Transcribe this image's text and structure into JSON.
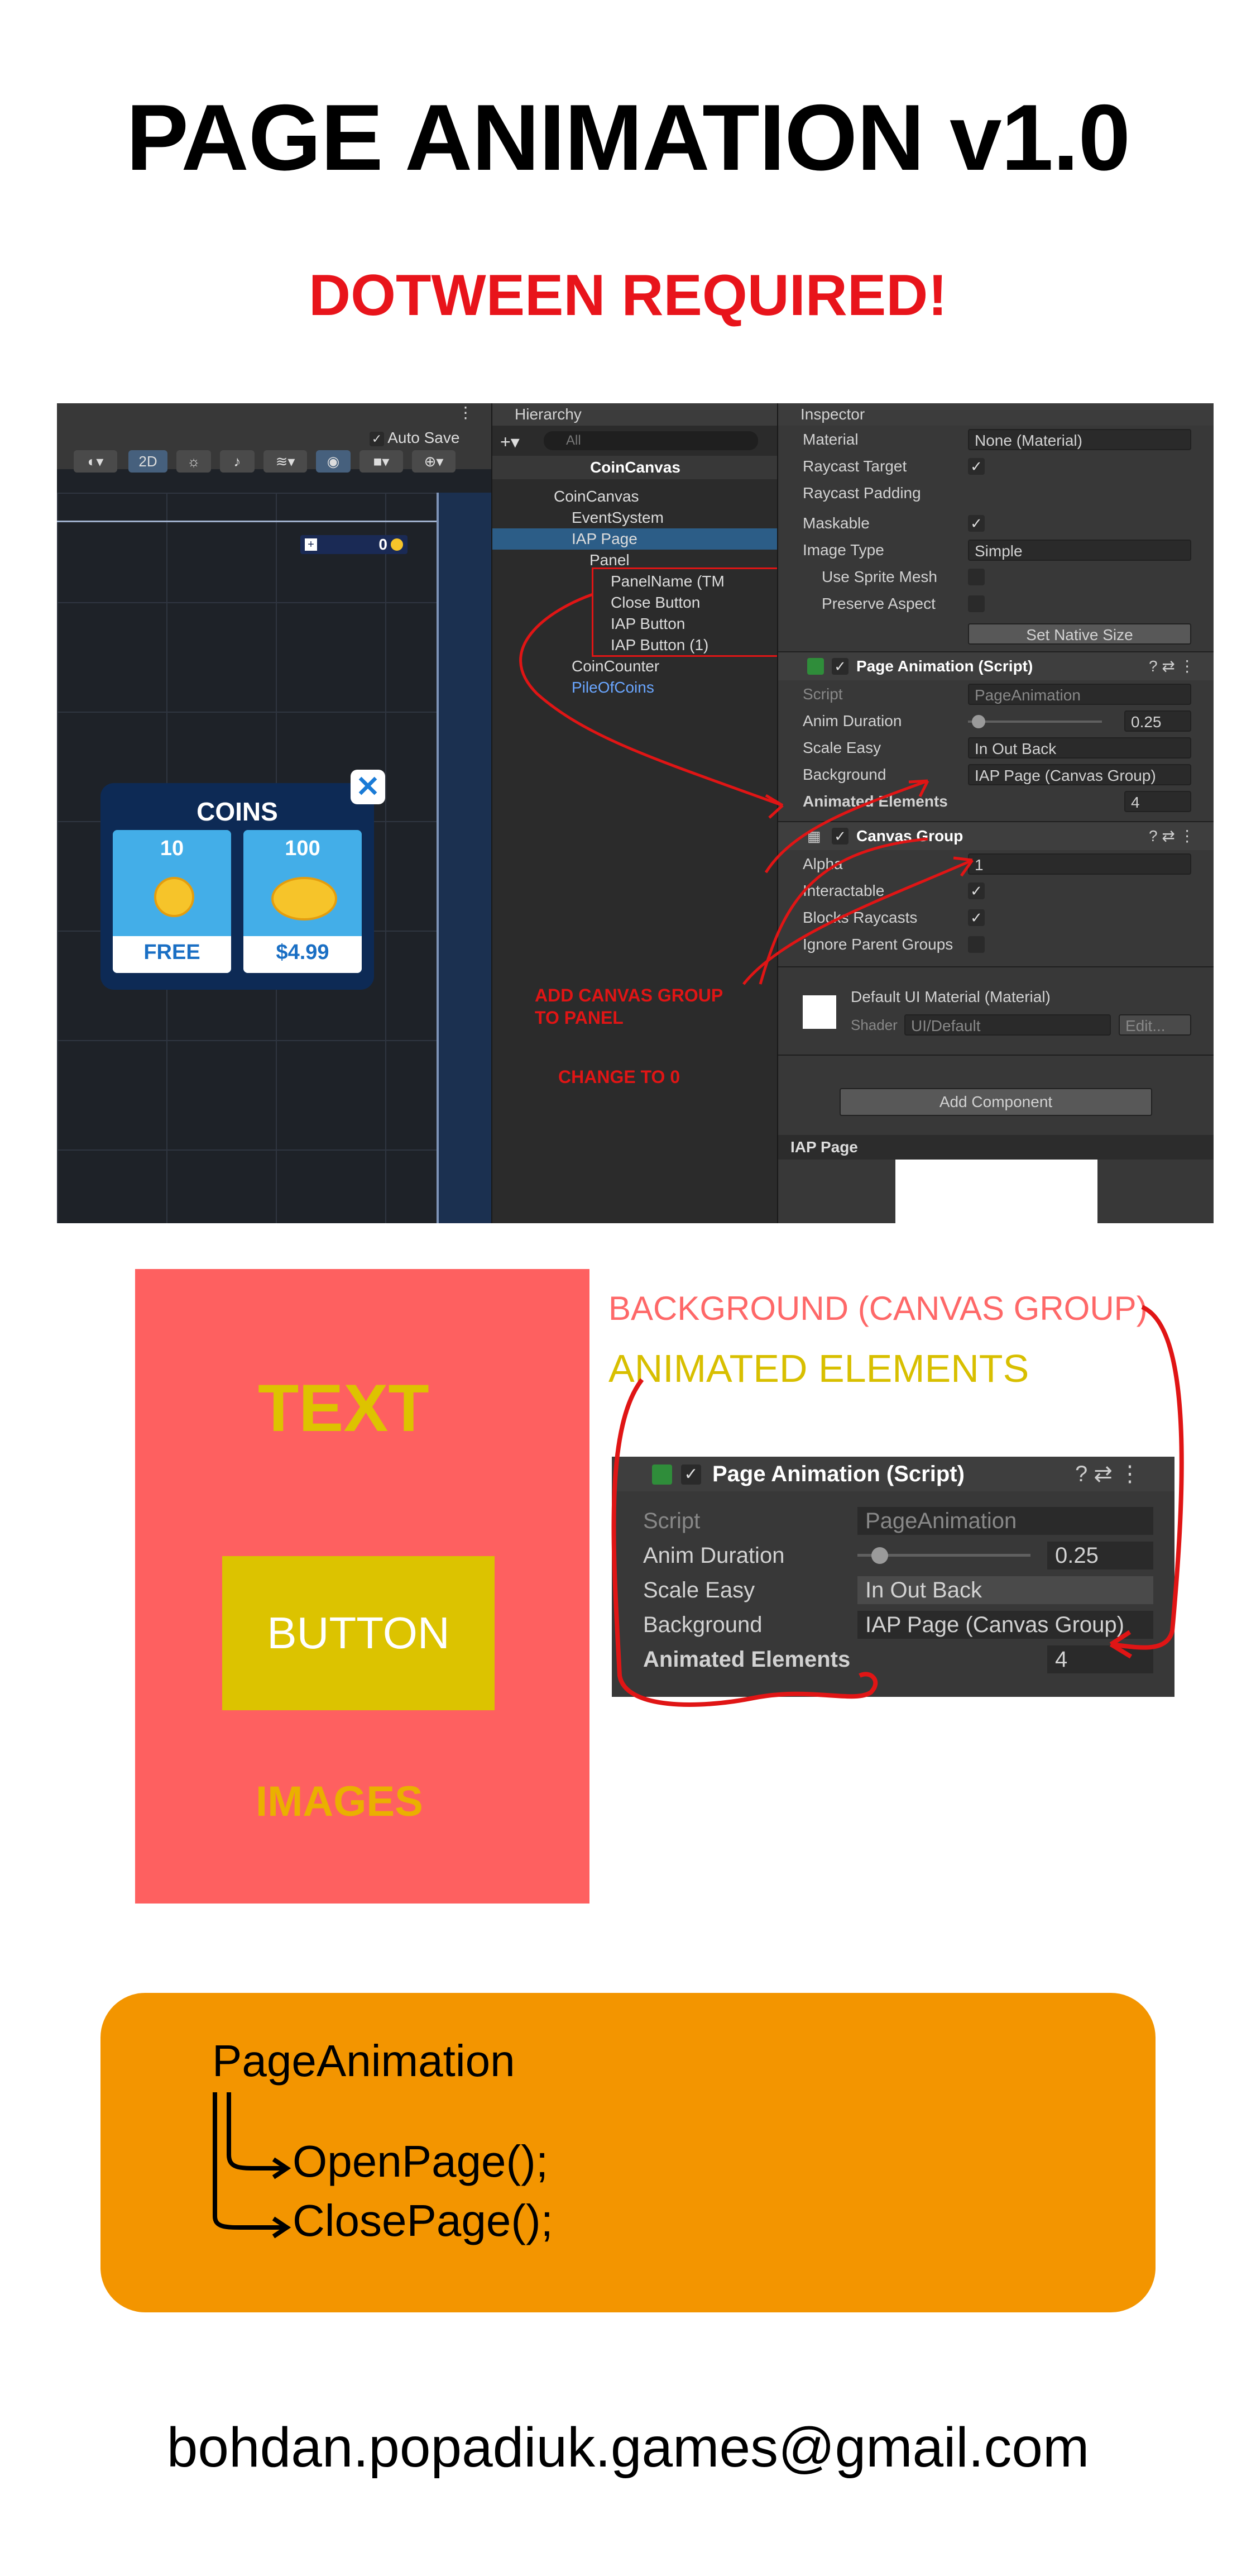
{
  "header": {
    "title": "PAGE ANIMATION v1.0",
    "requirement": "DOTWEEN REQUIRED!"
  },
  "editor": {
    "scene": {
      "auto_save_label": "Auto Save",
      "mode_2d": "2D",
      "coin_counter_value": "0",
      "coins_panel": {
        "title": "COINS",
        "cards": [
          {
            "amount": "10",
            "price": "FREE"
          },
          {
            "amount": "100",
            "price": "$4.99"
          }
        ]
      }
    },
    "hierarchy": {
      "tab_label": "Hierarchy",
      "search_placeholder": "All",
      "root": "CoinCanvas",
      "items": [
        {
          "label": "CoinCanvas"
        },
        {
          "label": "EventSystem"
        },
        {
          "label": "IAP Page"
        },
        {
          "label": "Panel"
        },
        {
          "label": "PanelName (TM"
        },
        {
          "label": "Close Button"
        },
        {
          "label": "IAP Button"
        },
        {
          "label": "IAP Button (1)"
        },
        {
          "label": "CoinCounter"
        },
        {
          "label": "PileOfCoins"
        }
      ]
    },
    "inspector": {
      "tab_label": "Inspector",
      "image_props": [
        {
          "label": "Material",
          "value": "None (Material)"
        },
        {
          "label": "Raycast Target",
          "value": "✓"
        },
        {
          "label": "Raycast Padding",
          "value": ""
        },
        {
          "label": "Maskable",
          "value": "✓"
        },
        {
          "label": "Image Type",
          "value": "Simple"
        },
        {
          "label": "Use Sprite Mesh",
          "value": ""
        },
        {
          "label": "Preserve Aspect",
          "value": ""
        }
      ],
      "set_native_size": "Set Native Size",
      "page_animation": {
        "header": "Page Animation (Script)",
        "script_label": "Script",
        "script_value": "PageAnimation",
        "anim_duration_label": "Anim Duration",
        "anim_duration_value": "0.25",
        "anim_duration_fraction": 0.08,
        "scale_easy_label": "Scale Easy",
        "scale_easy_value": "In Out Back",
        "background_label": "Background",
        "background_value": "IAP Page (Canvas Group)",
        "animated_elements_label": "Animated Elements",
        "animated_elements_value": "4"
      },
      "canvas_group": {
        "header": "Canvas Group",
        "alpha_label": "Alpha",
        "alpha_value": "1",
        "interactable_label": "Interactable",
        "blocks_raycasts_label": "Blocks Raycasts",
        "ignore_parent_label": "Ignore Parent Groups"
      },
      "material": {
        "name": "Default UI Material (Material)",
        "shader_label": "Shader",
        "shader_value": "UI/Default",
        "edit_label": "Edit..."
      },
      "add_component": "Add Component",
      "footer_tab": "IAP Page"
    },
    "annotations": {
      "add_canvas_group": "ADD CANVAS GROUP\nTO PANEL",
      "change_to_0": "CHANGE TO 0"
    }
  },
  "diagram": {
    "text_label": "TEXT",
    "button_label": "BUTTON",
    "images_label": "IMAGES",
    "annotation_background": "BACKGROUND (CANVAS GROUP)",
    "annotation_elements": "ANIMATED ELEMENTS"
  },
  "code": {
    "class_name": "PageAnimation",
    "method_open": "OpenPage();",
    "method_close": "ClosePage();"
  },
  "contact": {
    "email": "bohdan.popadiuk.games@gmail.com"
  },
  "colors": {
    "red_accent": "#e8141b",
    "panel_red": "#fe6060",
    "yellow": "#ddc300",
    "orange": "#f39500",
    "unity_dark": "#383838"
  }
}
